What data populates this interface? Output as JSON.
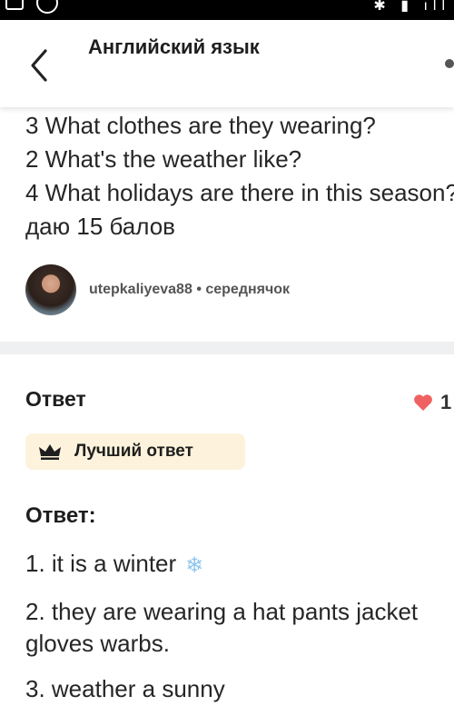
{
  "app_bar": {
    "title": "Английский язык"
  },
  "question": {
    "lines": [
      "3 What clothes are they wearing?",
      "2 What's the weather like?",
      "4 What holidays are there in this season?",
      "даю 15 балов"
    ],
    "author": {
      "username": "utepkaliyeva88",
      "rank": "середнячок"
    }
  },
  "answer_section": {
    "heading": "Ответ",
    "likes": "1",
    "best_badge": "Лучший ответ",
    "answer_label": "Ответ:",
    "lines": [
      "1. it is a winter",
      "2. they are wearing a hat pants jacket",
      "gloves warbs.",
      "3. weather a sunny"
    ]
  },
  "colors": {
    "heart": "#f06262",
    "badge_bg": "#fdf3dc",
    "divider": "#eef0f2"
  },
  "icons": [
    "back-arrow-icon",
    "more-options-icon",
    "heart-icon",
    "crown-icon",
    "snowflake-icon"
  ]
}
